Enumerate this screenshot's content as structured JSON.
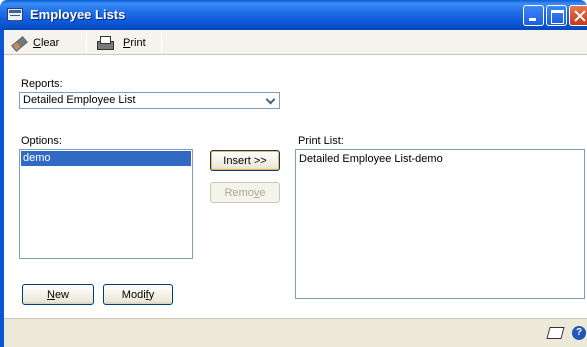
{
  "window": {
    "title": "Employee Lists"
  },
  "toolbar": {
    "clear_label": "Clear",
    "clear_underline": "C",
    "clear_rest": "lear",
    "print_label": "Print",
    "print_underline": "P",
    "print_rest": "rint"
  },
  "form": {
    "reports_label": "Reports:",
    "reports_selected": "Detailed Employee List",
    "options_label": "Options:",
    "options_items": [
      "demo"
    ],
    "print_list_label": "Print List:",
    "print_list_items": [
      "Detailed Employee List-demo"
    ]
  },
  "buttons": {
    "insert": "Insert >>",
    "remove_pre": "Remo",
    "remove_u": "v",
    "remove_post": "e",
    "new_u": "N",
    "new_rest": "ew",
    "modify_pre": "Modi",
    "modify_u": "f",
    "modify_post": "y"
  },
  "statusbar": {
    "help_glyph": "?"
  },
  "colors": {
    "titlebar": "#0a55d2",
    "selection": "#316ac5"
  }
}
